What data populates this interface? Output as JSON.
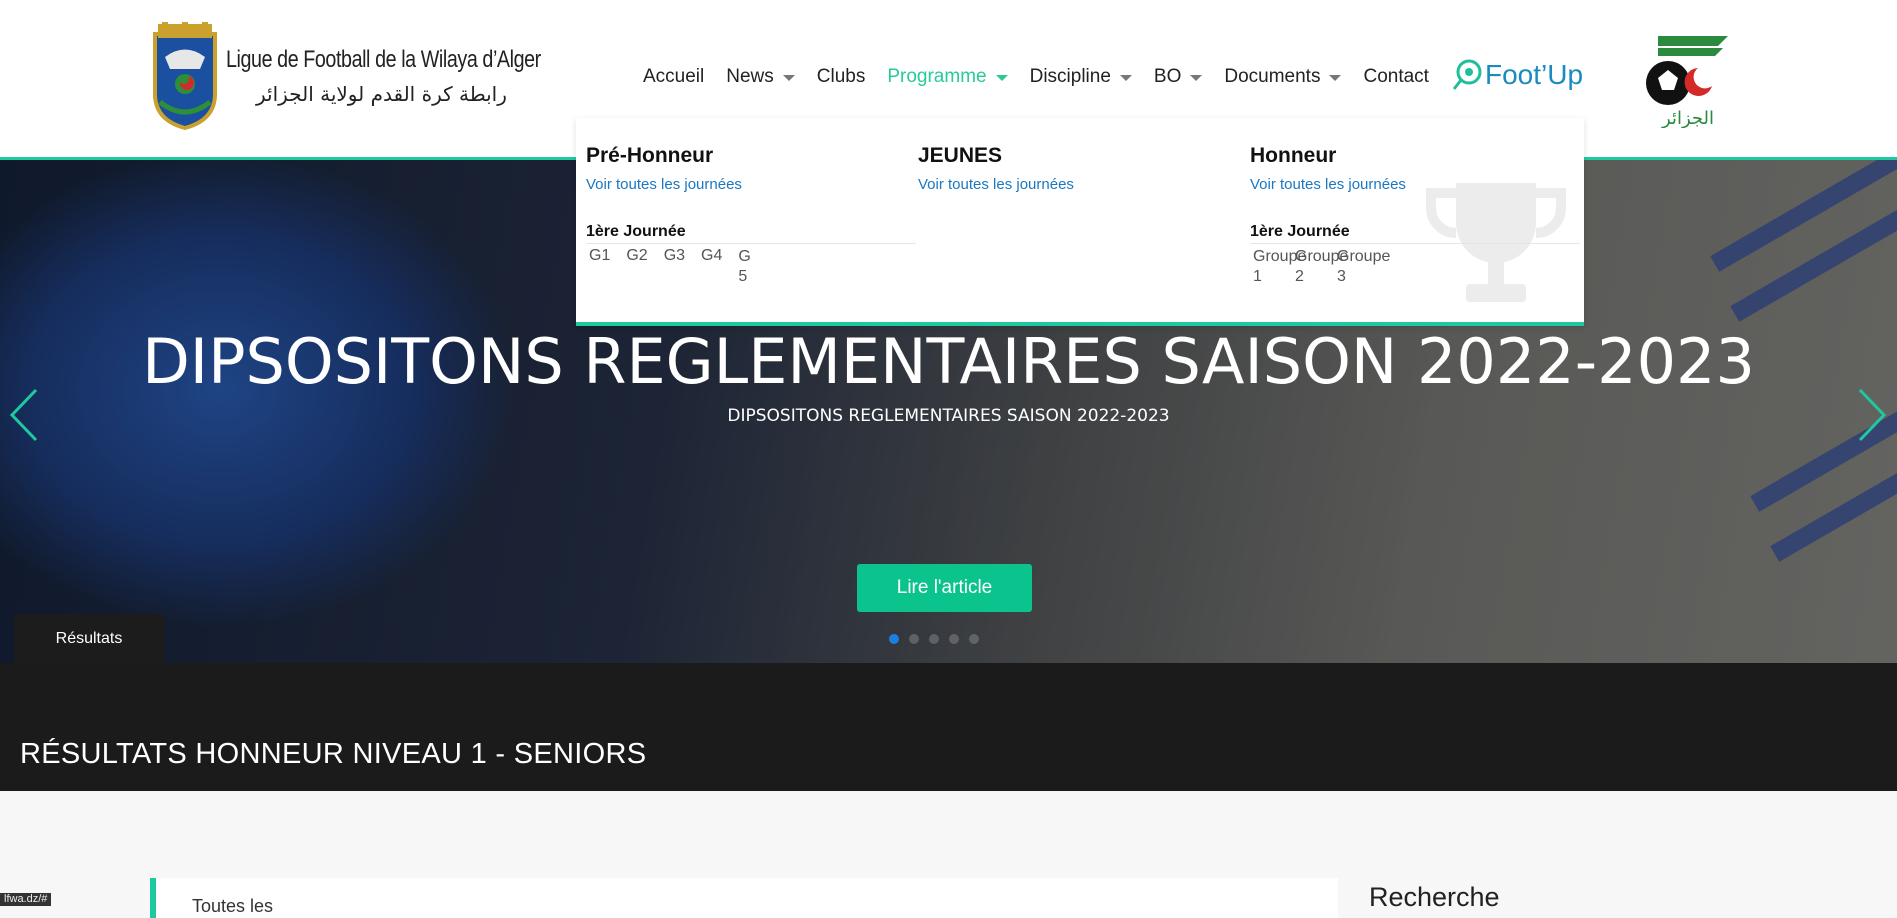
{
  "header": {
    "logo_fr": "Ligue de Football de la Wilaya d’Alger",
    "logo_ar": "رابطة كرة القدم لولاية الجزائر",
    "nav": [
      {
        "label": "Accueil",
        "dropdown": false
      },
      {
        "label": "News",
        "dropdown": true
      },
      {
        "label": "Clubs",
        "dropdown": false
      },
      {
        "label": "Programme",
        "dropdown": true,
        "active": true
      },
      {
        "label": "Discipline",
        "dropdown": true
      },
      {
        "label": "BO",
        "dropdown": true
      },
      {
        "label": "Documents",
        "dropdown": true
      },
      {
        "label": "Contact",
        "dropdown": false
      }
    ],
    "footup_label": "Foot’Up",
    "faf_label": "الجزائر"
  },
  "dropdown": {
    "columns": [
      {
        "title": "Pré-Honneur",
        "link": "Voir toutes les journées",
        "journee": "1ère Journée",
        "groups": [
          "G1",
          "G2",
          "G3",
          "G4",
          "G5"
        ]
      },
      {
        "title": "JEUNES",
        "link": "Voir toutes les journées",
        "journee": "",
        "groups": []
      },
      {
        "title": "Honneur",
        "link": "Voir toutes les journées",
        "journee": "1ère Journée",
        "groups": [
          "Groupe 1",
          "Groupe 2",
          "Groupe 3"
        ]
      }
    ]
  },
  "hero": {
    "title": "DIPSOSITONS REGLEMENTAIRES SAISON 2022-2023",
    "subtitle": "DIPSOSITONS REGLEMENTAIRES SAISON 2022-2023",
    "button": "Lire l'article",
    "tab": "Résultats",
    "slide_count": 5,
    "active_slide": 1
  },
  "results": {
    "title": "RÉSULTATS HONNEUR NIVEAU 1 - SENIORS"
  },
  "content": {
    "card_text": "Toutes les",
    "sidebar_title": "Recherche"
  },
  "status_url": "lfwa.dz/#",
  "colors": {
    "accent": "#1ec9a0",
    "button": "#0bc48d",
    "link": "#1a78c2",
    "dark": "#1b1b1c"
  }
}
